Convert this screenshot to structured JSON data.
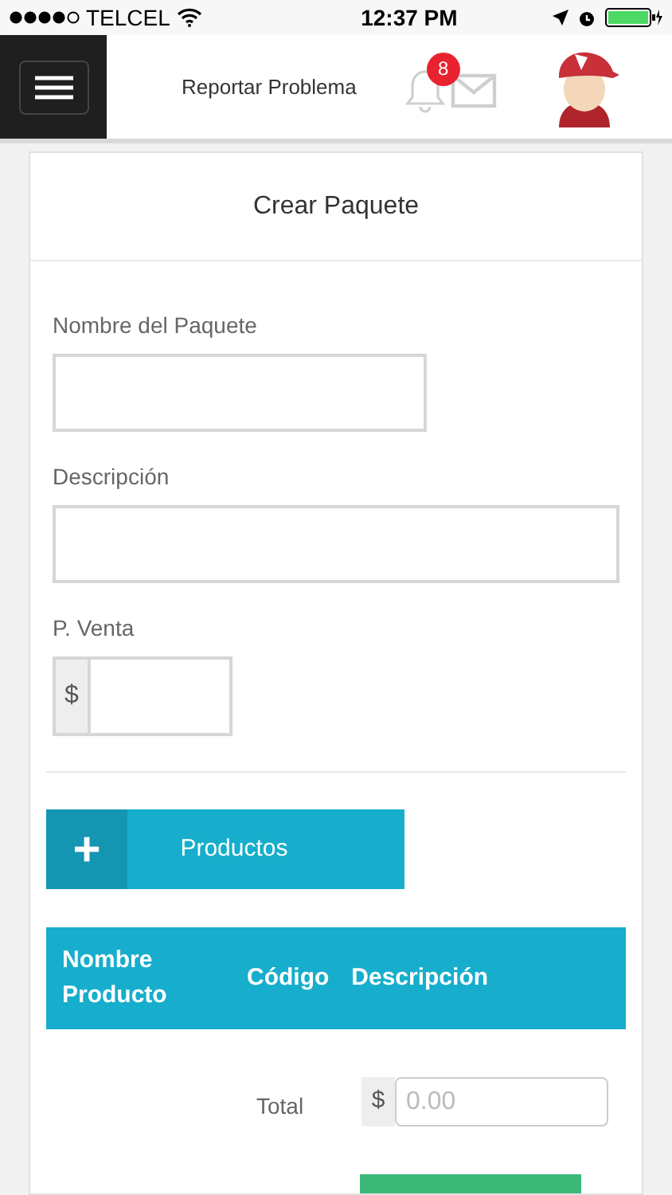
{
  "status_bar": {
    "carrier": "TELCEL",
    "time": "12:37 PM"
  },
  "header": {
    "link": "Reportar Problema",
    "notifications": "8"
  },
  "form": {
    "title": "Crear Paquete",
    "fields": [
      {
        "label": "Nombre del Paquete",
        "kind": "text"
      },
      {
        "label": "Descripción",
        "kind": "wide"
      },
      {
        "label": "P. Venta",
        "kind": "money",
        "prefix": "$"
      }
    ],
    "add_button": {
      "icon": "+",
      "label": "Productos"
    },
    "table": {
      "columns": [
        "Nombre Producto",
        "Código",
        "Descripción"
      ]
    },
    "total": {
      "label": "Total",
      "prefix": "$",
      "placeholder": "0.00"
    }
  }
}
